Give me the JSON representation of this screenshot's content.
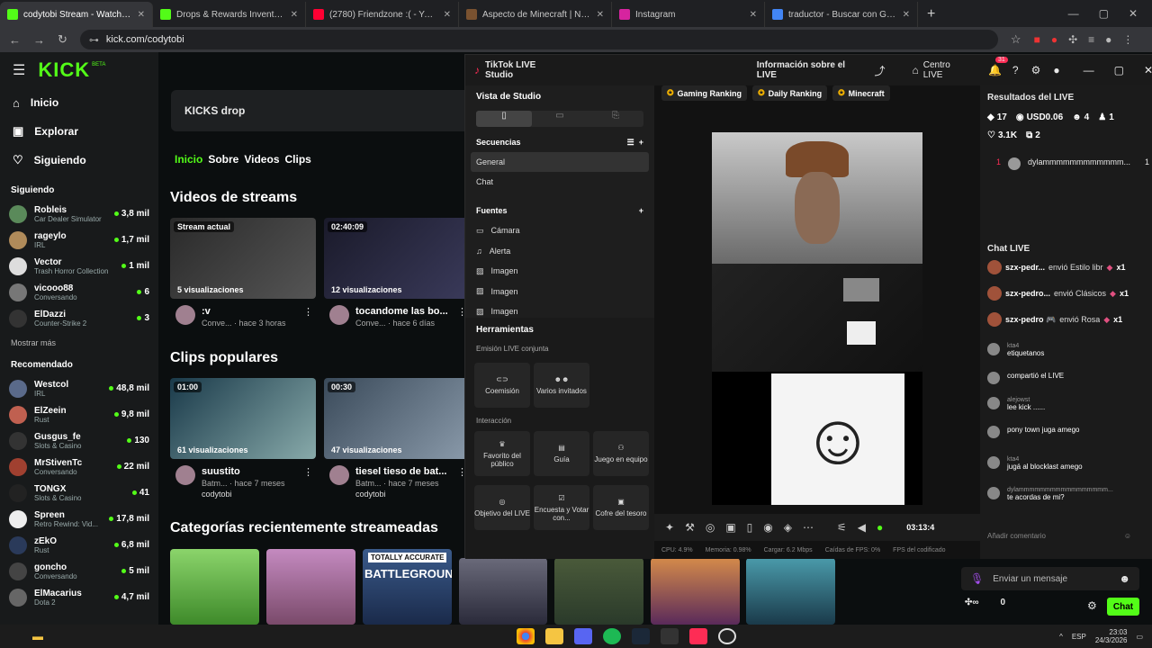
{
  "browser": {
    "tabs": [
      {
        "label": "codytobi Stream - Watch Live o",
        "color": "#53fc18",
        "active": true
      },
      {
        "label": "Drops & Rewards Inventory - K",
        "color": "#53fc18",
        "active": false
      },
      {
        "label": "(2780) Friendzone :( - YouTube",
        "color": "#ff0033",
        "active": false
      },
      {
        "label": "Aspecto de Minecraft | NameM",
        "color": "#7a5230",
        "active": false
      },
      {
        "label": "Instagram",
        "color": "#d6249f",
        "active": false
      },
      {
        "label": "traductor - Buscar con Google",
        "color": "#4285f4",
        "active": false
      }
    ],
    "new_tab": "+",
    "url": "kick.com/codytobi"
  },
  "kick": {
    "logo": "KICK",
    "beta": "BETA",
    "nav": [
      {
        "label": "Inicio",
        "icon": "home-icon",
        "glyph": "⌂"
      },
      {
        "label": "Explorar",
        "icon": "compass-icon",
        "glyph": "▣"
      },
      {
        "label": "Siguiendo",
        "icon": "heart-icon",
        "glyph": "♡"
      }
    ],
    "following_title": "Siguiendo",
    "following": [
      {
        "name": "Robleis",
        "cat": "Car Dealer Simulator",
        "v": "3,8 mil",
        "c": "#5a8a5a"
      },
      {
        "name": "rageylo",
        "cat": "IRL",
        "v": "1,7 mil",
        "c": "#b08b5a"
      },
      {
        "name": "Vector",
        "cat": "Trash Horror Collection",
        "v": "1 mil",
        "c": "#ddd"
      },
      {
        "name": "vicooo88",
        "cat": "Conversando",
        "v": "6",
        "c": "#777"
      },
      {
        "name": "ElDazzi",
        "cat": "Counter-Strike 2",
        "v": "3",
        "c": "#333"
      }
    ],
    "show_more": "Mostrar más",
    "recommended_title": "Recomendado",
    "recommended": [
      {
        "name": "Westcol",
        "cat": "IRL",
        "v": "48,8 mil",
        "c": "#5a6a8a"
      },
      {
        "name": "ElZeein",
        "cat": "Rust",
        "v": "9,8 mil",
        "c": "#c06050"
      },
      {
        "name": "Gusgus_fe",
        "cat": "Slots & Casino",
        "v": "130",
        "c": "#333"
      },
      {
        "name": "MrStivenTc",
        "cat": "Conversando",
        "v": "22 mil",
        "c": "#a04030"
      },
      {
        "name": "TONGX",
        "cat": "Slots & Casino",
        "v": "41",
        "c": "#222"
      },
      {
        "name": "Spreen",
        "cat": "Retro Rewind: Vid...",
        "v": "17,8 mil",
        "c": "#eee"
      },
      {
        "name": "zEkO",
        "cat": "Rust",
        "v": "6,8 mil",
        "c": "#2a3a5a"
      },
      {
        "name": "goncho",
        "cat": "Conversando",
        "v": "5 mil",
        "c": "#444"
      },
      {
        "name": "ElMacarius",
        "cat": "Dota 2",
        "v": "4,7 mil",
        "c": "#666"
      }
    ],
    "drops_title": "KICKS drop",
    "tabs": [
      "Inicio",
      "Sobre",
      "Videos",
      "Clips"
    ],
    "videos_title": "Videos de streams",
    "videos": [
      {
        "badge": "Stream actual",
        "views": "5 visualizaciones",
        "title": ":v",
        "sub": "Conve... · hace 3 horas"
      },
      {
        "badge": "02:40:09",
        "views": "12 visualizaciones",
        "title": "tocandome las bo...",
        "sub": "Conve... · hace 6 días"
      }
    ],
    "clips_title": "Clips populares",
    "clips": [
      {
        "badge": "01:00",
        "views": "61 visualizaciones",
        "title": "suustito",
        "sub": "Batm... · hace 7 meses",
        "author": "codytobi"
      },
      {
        "badge": "00:30",
        "views": "47 visualizaciones",
        "title": "tiesel tieso de bat...",
        "sub": "Batm... · hace 7 meses",
        "author": "codytobi"
      }
    ],
    "categories_title": "Categorías recientemente streameadas",
    "battlegrounds_top": "TOTALLY ACCURATE",
    "battlegrounds": "BATTLEGROUNDS"
  },
  "studio": {
    "title": "TikTok LIVE Studio",
    "live_info": "Información sobre el LIVE",
    "live_center": "Centro LIVE",
    "notif_count": "31",
    "view": "Vista de Studio",
    "sequences": "Secuencias",
    "seq_items": [
      "General",
      "Chat"
    ],
    "sources": "Fuentes",
    "source_items": [
      {
        "l": "Cámara",
        "g": "▭"
      },
      {
        "l": "Alerta",
        "g": "♫"
      },
      {
        "l": "Imagen",
        "g": "▨"
      },
      {
        "l": "Imagen",
        "g": "▨"
      },
      {
        "l": "Imagen",
        "g": "▨"
      }
    ],
    "tools": "Herramientas",
    "joint": "Emisión LIVE conjunta",
    "joint_tools": [
      "Coemisión",
      "Varios invitados"
    ],
    "interaction": "Interacción",
    "inter_tools": [
      "Favorito del público",
      "Guía",
      "Juego en equipo",
      "Objetivo del LIVE",
      "Encuesta y Votar con...",
      "Cofre del tesoro"
    ],
    "rankings": [
      "Gaming Ranking",
      "Daily Ranking",
      "Minecraft"
    ],
    "results_title": "Resultados del LIVE",
    "stats": [
      "17",
      "USD0.06",
      "4",
      "1"
    ],
    "likes": "3.1K",
    "shares": "2",
    "top_rank": "1",
    "top_user": "dylammmmmmmmmmmm...",
    "top_val": "1",
    "chat_title": "Chat LIVE",
    "gifts": [
      {
        "user": "szx-pedr...",
        "text": "envió Estilo libr",
        "x": "x1"
      },
      {
        "user": "szx-pedro...",
        "text": "envió Clásicos",
        "x": "x1"
      },
      {
        "user": "szx-pedro 🎮",
        "text": "envió Rosa",
        "x": "x1"
      }
    ],
    "comments": [
      {
        "user": "kta4",
        "text": "etiquetanos"
      },
      {
        "user": "",
        "text": "compartió el LIVE"
      },
      {
        "user": "alejowst",
        "text": "lee kick ......"
      },
      {
        "user": "",
        "text": "pony town juga amego"
      },
      {
        "user": "kta4",
        "text": "jugá al blocklast amego"
      },
      {
        "user": "dylammmmmmmmmmmmmmmmm...",
        "text": "te acordas de mi?"
      }
    ],
    "add_comment": "Añadir comentario",
    "timer": "03:13:4",
    "status": [
      "CPU: 4.9%",
      "Memoria: 0.98%",
      "Cargar: 6.2 Mbps",
      "Caídas de FPS: 0%",
      "FPS del codificado"
    ]
  },
  "kickchat": {
    "placeholder": "Enviar un mensaje",
    "count": "0",
    "button": "Chat"
  },
  "taskbar": {
    "lang": "ESP",
    "time": "23:03",
    "date": "24/3/2026"
  }
}
